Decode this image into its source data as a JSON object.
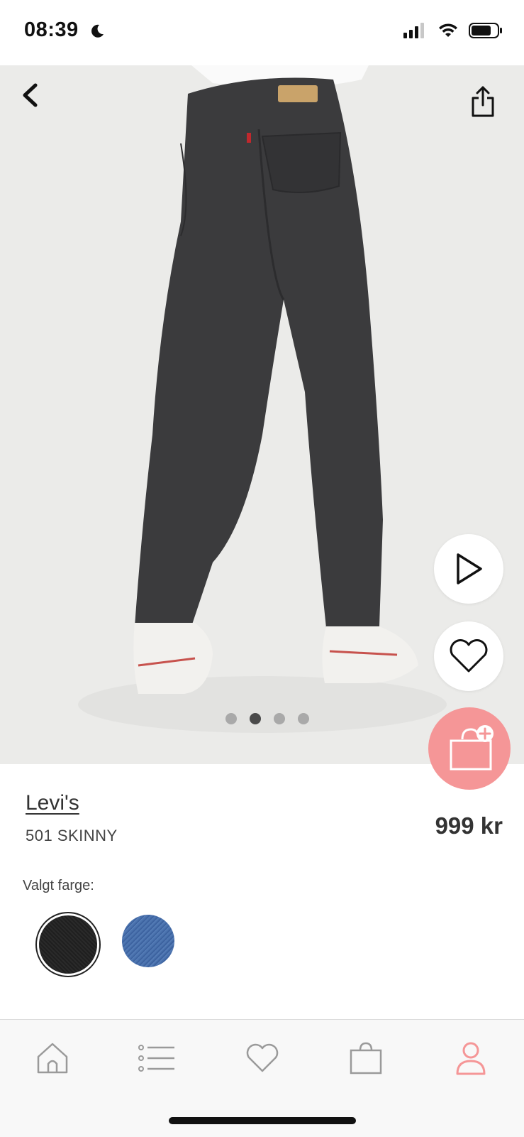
{
  "status_bar": {
    "time": "08:39"
  },
  "product": {
    "brand": "Levi's",
    "model": "501 SKINNY",
    "price": "999 kr",
    "color_label": "Valgt farge:",
    "swatches": [
      {
        "name": "black",
        "color": "#222222",
        "selected": true
      },
      {
        "name": "blue",
        "color": "#4a72ad",
        "selected": false
      }
    ]
  },
  "gallery": {
    "images": 4,
    "current": 2
  },
  "tabs": [
    {
      "name": "home",
      "icon": "home-icon"
    },
    {
      "name": "categories",
      "icon": "list-icon"
    },
    {
      "name": "favorites",
      "icon": "heart-icon"
    },
    {
      "name": "bag",
      "icon": "bag-icon"
    },
    {
      "name": "profile",
      "icon": "person-icon",
      "active": true
    }
  ],
  "colors": {
    "accent": "#f59697",
    "tab_inactive": "#9a9a9a"
  }
}
